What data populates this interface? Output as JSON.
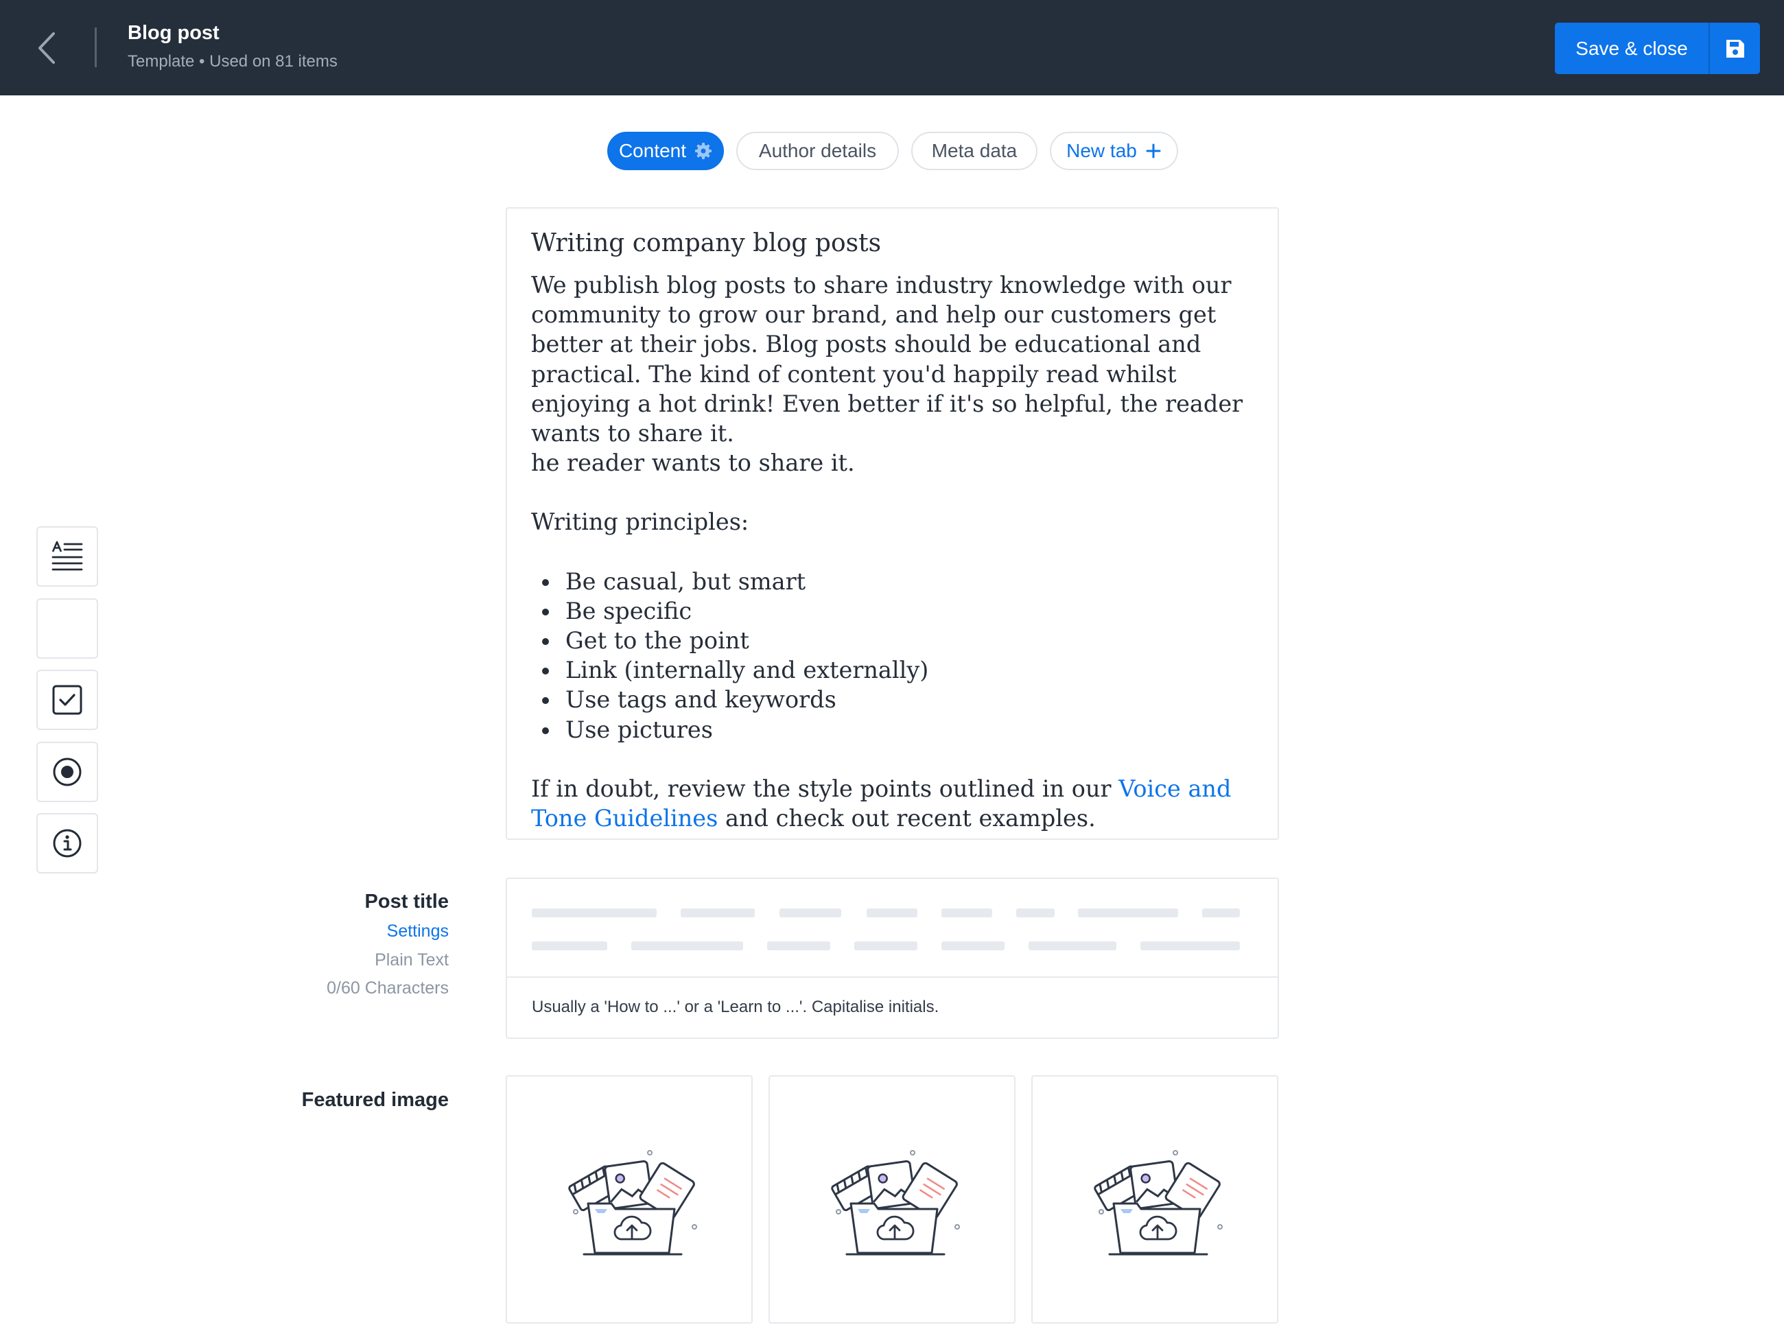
{
  "header": {
    "title": "Blog post",
    "subtitle": "Template • Used on 81 items",
    "save_label": "Save & close"
  },
  "tabs": [
    {
      "label": "Content",
      "active": true
    },
    {
      "label": "Author details",
      "active": false
    },
    {
      "label": "Meta data",
      "active": false
    },
    {
      "label": "New tab",
      "active": false
    }
  ],
  "toolbar": {
    "tools": [
      "text-block-icon",
      "blank-tool",
      "checkbox-icon",
      "radio-icon",
      "info-icon"
    ]
  },
  "guidance": {
    "heading": "Writing company blog posts",
    "intro": "We publish blog posts to share industry knowledge with our community to grow our brand, and help our customers get better at their jobs. Blog posts should be educational and practical. The kind of content you'd happily read whilst enjoying a hot drink! Even better if it's so helpful, the reader wants to share it.",
    "intro_fragment": "he reader wants to share it.",
    "principles_heading": "Writing principles:",
    "principles": [
      "Be casual, but smart",
      "Be specific",
      "Get to the point",
      "Link (internally and externally)",
      "Use tags and keywords",
      "Use pictures"
    ],
    "outro_before": "If in doubt, review the style points outlined in our ",
    "outro_link": "Voice and Tone Guidelines",
    "outro_after": " and check out recent examples."
  },
  "post_title_field": {
    "label": "Post title",
    "settings_link": "Settings",
    "type": "Plain Text",
    "char_count": "0/60 Characters",
    "help_text": "Usually a 'How to ...' or a 'Learn to ...'. Capitalise initials."
  },
  "featured_image_field": {
    "label": "Featured image",
    "slots": 3
  },
  "colors": {
    "topbar": "#252e3b",
    "accent": "#0d74e9",
    "border": "#e6e9ed"
  }
}
